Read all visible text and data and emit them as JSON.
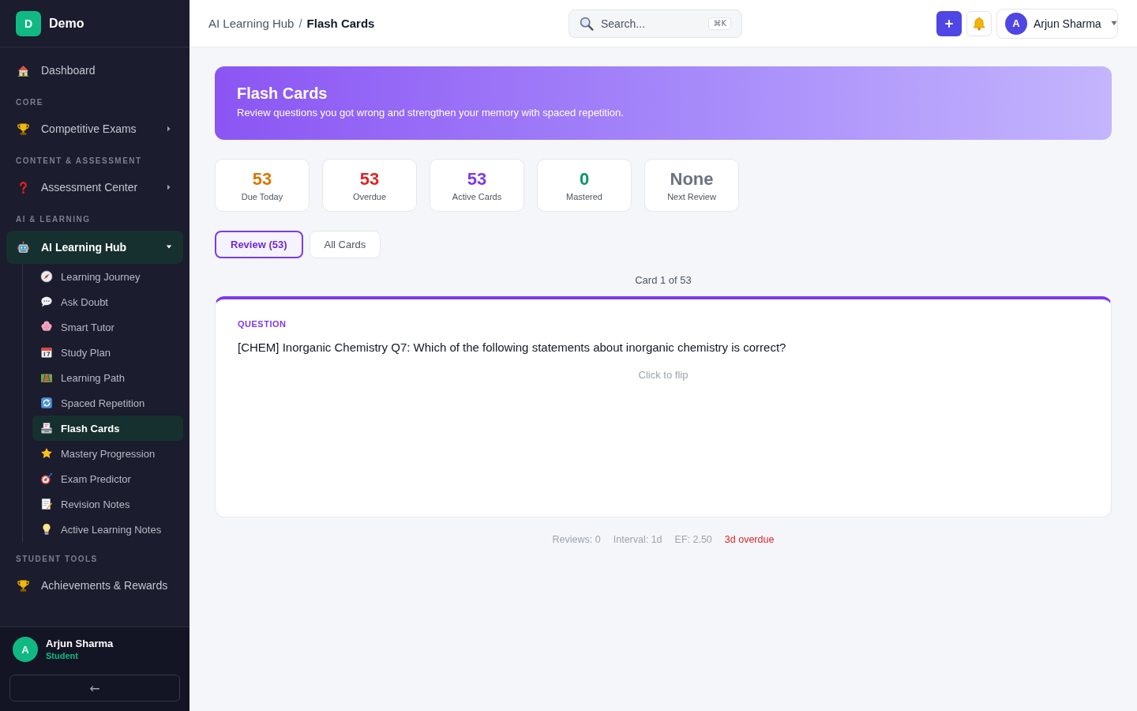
{
  "sidebar": {
    "brand": {
      "initial": "D",
      "name": "Demo"
    },
    "sections": [
      {
        "items": [
          {
            "label": "Dashboard",
            "selected": false
          }
        ]
      },
      {
        "title": "CORE",
        "items": [
          {
            "label": "Competitive Exams",
            "selected": false,
            "expanded": false
          }
        ]
      },
      {
        "title": "CONTENT & ASSESSMENT",
        "items": [
          {
            "label": "Assessment Center",
            "selected": false,
            "expanded": false
          }
        ]
      },
      {
        "title": "AI & LEARNING",
        "items": [
          {
            "label": "AI Learning Hub",
            "selected": true,
            "expanded": true,
            "children": [
              {
                "label": "Learning Journey",
                "selected": false
              },
              {
                "label": "Ask Doubt",
                "selected": false
              },
              {
                "label": "Smart Tutor",
                "selected": false
              },
              {
                "label": "Study Plan",
                "selected": false
              },
              {
                "label": "Learning Path",
                "selected": false
              },
              {
                "label": "Spaced Repetition",
                "selected": false
              },
              {
                "label": "Flash Cards",
                "selected": true
              },
              {
                "label": "Mastery Progression",
                "selected": false
              },
              {
                "label": "Exam Predictor",
                "selected": false
              },
              {
                "label": "Revision Notes",
                "selected": false
              },
              {
                "label": "Active Learning Notes",
                "selected": false
              }
            ]
          }
        ]
      },
      {
        "title": "STUDENT TOOLS",
        "items": [
          {
            "label": "Achievements & Rewards",
            "selected": false
          }
        ]
      }
    ],
    "user": {
      "initial": "A",
      "name": "Arjun Sharma",
      "role": "Student"
    },
    "collapse_button": {
      "label": "←"
    }
  },
  "header": {
    "breadcrumb": [
      {
        "label": "AI Learning Hub"
      },
      {
        "label": "Flash Cards"
      }
    ],
    "breadcrumb_separator": "/",
    "search": {
      "placeholder": "Search...",
      "shortcut": "⌘K"
    },
    "user_menu": {
      "initial": "A",
      "name": "Arjun Sharma"
    }
  },
  "banner": {
    "title": "Flash Cards",
    "subtitle": "Review questions you got wrong and strengthen your memory with spaced repetition."
  },
  "stats": [
    {
      "value": "53",
      "label": "Due Today",
      "color": "#d97706"
    },
    {
      "value": "53",
      "label": "Overdue",
      "color": "#dc2626"
    },
    {
      "value": "53",
      "label": "Active Cards",
      "color": "#7c3aed"
    },
    {
      "value": "0",
      "label": "Mastered",
      "color": "#059669"
    },
    {
      "value": "None",
      "label": "Next Review",
      "color": "#6b7280"
    }
  ],
  "tabs": [
    {
      "label": "Review (53)",
      "selected": true
    },
    {
      "label": "All Cards",
      "selected": false
    }
  ],
  "card": {
    "counter": "Card 1 of 53",
    "side_label": "QUESTION",
    "text": "[CHEM] Inorganic Chemistry Q7: Which of the following statements about inorganic chemistry is correct?",
    "hint": "Click to flip"
  },
  "card_meta": [
    {
      "kind": "info",
      "text": "Reviews: 0"
    },
    {
      "kind": "info",
      "text": "Interval: 1d"
    },
    {
      "kind": "info",
      "text": "EF: 2.50"
    },
    {
      "kind": "alert",
      "text": "3d overdue"
    }
  ]
}
